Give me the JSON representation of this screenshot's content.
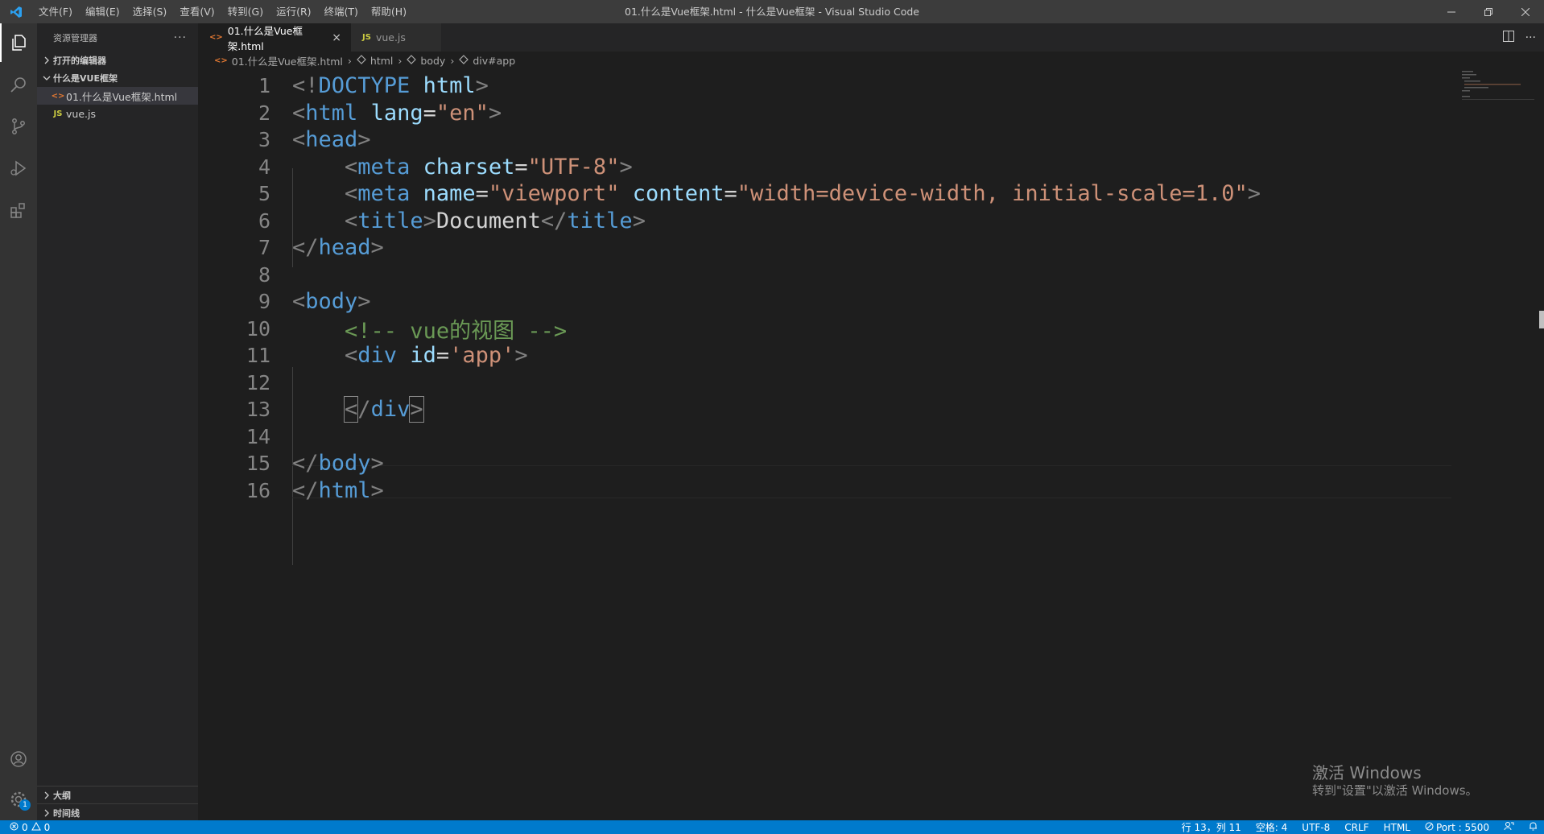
{
  "titlebar": {
    "menus": [
      "文件(F)",
      "编辑(E)",
      "选择(S)",
      "查看(V)",
      "转到(G)",
      "运行(R)",
      "终端(T)",
      "帮助(H)"
    ],
    "title": "01.什么是Vue框架.html - 什么是Vue框架 - Visual Studio Code"
  },
  "sidebar": {
    "header": "资源管理器",
    "open_editors": "打开的编辑器",
    "folder": "什么是VUE框架",
    "files": [
      {
        "name": "01.什么是Vue框架.html",
        "icon": "html-icon"
      },
      {
        "name": "vue.js",
        "icon": "js-icon"
      }
    ],
    "outline": "大纲",
    "timeline": "时间线"
  },
  "tabs": [
    {
      "label": "01.什么是Vue框架.html",
      "active": true,
      "icon": "<>"
    },
    {
      "label": "vue.js",
      "active": false,
      "icon": "JS"
    }
  ],
  "breadcrumbs": [
    "01.什么是Vue框架.html",
    "html",
    "body",
    "div#app"
  ],
  "code": [
    {
      "n": "1",
      "tokens": [
        [
          "t-tag",
          "<!"
        ],
        [
          "t-name",
          "DOCTYPE"
        ],
        [
          "t-text",
          " "
        ],
        [
          "t-attr",
          "html"
        ],
        [
          "t-tag",
          ">"
        ]
      ]
    },
    {
      "n": "2",
      "tokens": [
        [
          "t-tag",
          "<"
        ],
        [
          "t-name",
          "html"
        ],
        [
          "t-text",
          " "
        ],
        [
          "t-attr",
          "lang"
        ],
        [
          "t-text",
          "="
        ],
        [
          "t-str",
          "\"en\""
        ],
        [
          "t-tag",
          ">"
        ]
      ]
    },
    {
      "n": "3",
      "tokens": [
        [
          "t-tag",
          "<"
        ],
        [
          "t-name",
          "head"
        ],
        [
          "t-tag",
          ">"
        ]
      ]
    },
    {
      "n": "4",
      "tokens": [
        [
          "t-text",
          "    "
        ],
        [
          "t-tag",
          "<"
        ],
        [
          "t-name",
          "meta"
        ],
        [
          "t-text",
          " "
        ],
        [
          "t-attr",
          "charset"
        ],
        [
          "t-text",
          "="
        ],
        [
          "t-str",
          "\"UTF-8\""
        ],
        [
          "t-tag",
          ">"
        ]
      ]
    },
    {
      "n": "5",
      "tokens": [
        [
          "t-text",
          "    "
        ],
        [
          "t-tag",
          "<"
        ],
        [
          "t-name",
          "meta"
        ],
        [
          "t-text",
          " "
        ],
        [
          "t-attr",
          "name"
        ],
        [
          "t-text",
          "="
        ],
        [
          "t-str",
          "\"viewport\""
        ],
        [
          "t-text",
          " "
        ],
        [
          "t-attr",
          "content"
        ],
        [
          "t-text",
          "="
        ],
        [
          "t-str",
          "\"width=device-width, initial-scale=1.0\""
        ],
        [
          "t-tag",
          ">"
        ]
      ]
    },
    {
      "n": "6",
      "tokens": [
        [
          "t-text",
          "    "
        ],
        [
          "t-tag",
          "<"
        ],
        [
          "t-name",
          "title"
        ],
        [
          "t-tag",
          ">"
        ],
        [
          "t-text",
          "Document"
        ],
        [
          "t-tag",
          "</"
        ],
        [
          "t-name",
          "title"
        ],
        [
          "t-tag",
          ">"
        ]
      ]
    },
    {
      "n": "7",
      "tokens": [
        [
          "t-tag",
          "</"
        ],
        [
          "t-name",
          "head"
        ],
        [
          "t-tag",
          ">"
        ]
      ]
    },
    {
      "n": "8",
      "tokens": []
    },
    {
      "n": "9",
      "tokens": [
        [
          "t-tag",
          "<"
        ],
        [
          "t-name",
          "body"
        ],
        [
          "t-tag",
          ">"
        ]
      ]
    },
    {
      "n": "10",
      "tokens": [
        [
          "t-text",
          "    "
        ],
        [
          "t-cmt",
          "<!-- vue的视图 -->"
        ]
      ]
    },
    {
      "n": "11",
      "tokens": [
        [
          "t-text",
          "    "
        ],
        [
          "t-tag",
          "<"
        ],
        [
          "t-name",
          "div"
        ],
        [
          "t-text",
          " "
        ],
        [
          "t-attr",
          "id"
        ],
        [
          "t-text",
          "="
        ],
        [
          "t-str",
          "'app'"
        ],
        [
          "t-tag",
          ">"
        ]
      ]
    },
    {
      "n": "12",
      "tokens": []
    },
    {
      "n": "13",
      "tokens": [
        [
          "t-text",
          "    "
        ],
        [
          "t-tag t-match",
          "<"
        ],
        [
          "t-tag",
          "/"
        ],
        [
          "t-name",
          "div"
        ],
        [
          "t-tag t-match",
          ">"
        ]
      ]
    },
    {
      "n": "14",
      "tokens": []
    },
    {
      "n": "15",
      "tokens": [
        [
          "t-tag",
          "</"
        ],
        [
          "t-name",
          "body"
        ],
        [
          "t-tag",
          ">"
        ]
      ]
    },
    {
      "n": "16",
      "tokens": [
        [
          "t-tag",
          "</"
        ],
        [
          "t-name",
          "html"
        ],
        [
          "t-tag",
          ">"
        ]
      ]
    }
  ],
  "watermark": {
    "line1": "激活 Windows",
    "line2": "转到\"设置\"以激活 Windows。"
  },
  "statusbar": {
    "errors": "0",
    "warnings": "0",
    "position": "行 13，列 11",
    "spaces": "空格: 4",
    "encoding": "UTF-8",
    "eol": "CRLF",
    "language": "HTML",
    "port": "Port : 5500"
  },
  "colors": {
    "accent": "#007acc",
    "background": "#1e1e1e"
  }
}
